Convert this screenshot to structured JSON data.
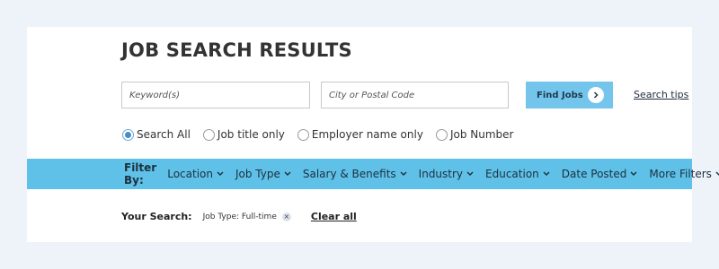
{
  "page": {
    "title": "JOB SEARCH RESULTS"
  },
  "search": {
    "keyword_placeholder": "Keyword(s)",
    "keyword_value": "",
    "location_placeholder": "City or Postal Code",
    "location_value": "",
    "find_label": "Find Jobs",
    "tips_label": "Search tips"
  },
  "scope": {
    "selected": "Search All",
    "options": [
      "Search All",
      "Job title only",
      "Employer name only",
      "Job Number"
    ]
  },
  "filters": {
    "label": "Filter By:",
    "items": [
      "Location",
      "Job Type",
      "Salary & Benefits",
      "Industry",
      "Education",
      "Date Posted",
      "More Filters"
    ]
  },
  "your_search": {
    "label": "Your Search:",
    "chips": [
      "Job Type: Full-time"
    ],
    "clear_label": "Clear all"
  },
  "colors": {
    "accent": "#5fc1e8",
    "button": "#74c5ec",
    "background": "#eef2f9"
  },
  "icons": {
    "find_button": "chevron-right-icon",
    "filter_dropdown": "chevron-down-icon",
    "chip_remove": "close-icon"
  }
}
